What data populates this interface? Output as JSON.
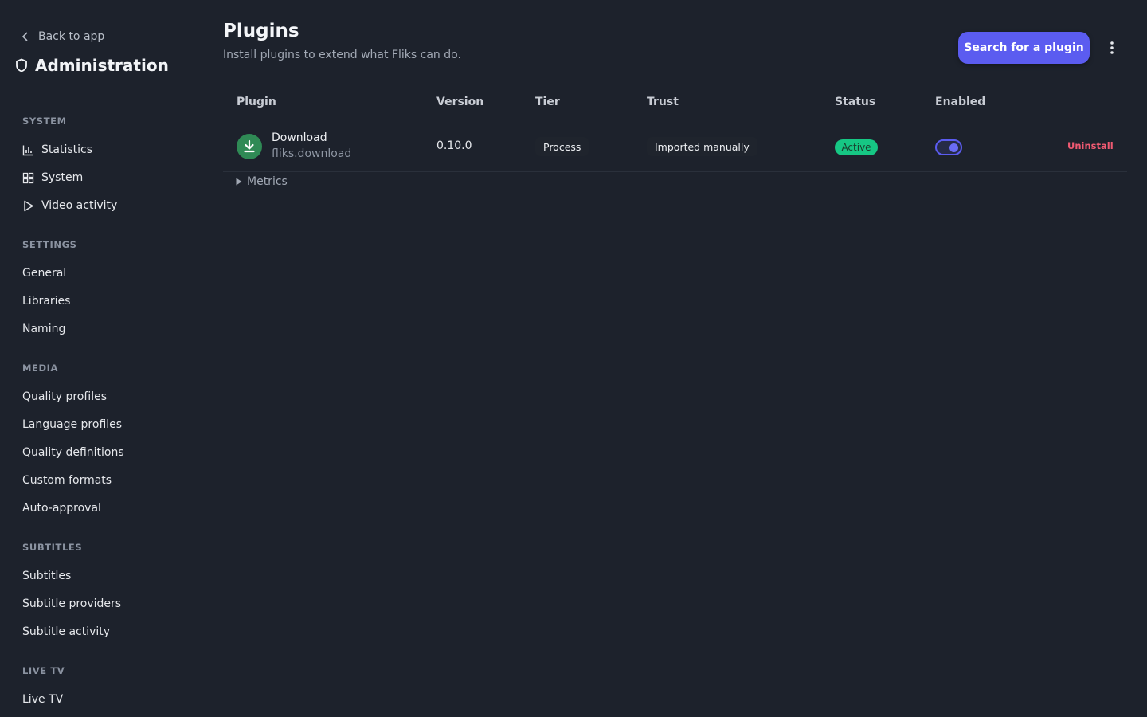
{
  "sidebar": {
    "back_label": "Back to app",
    "title": "Administration",
    "sections": [
      {
        "label": "SYSTEM",
        "items": [
          {
            "label": "Statistics",
            "icon": "bar-chart-icon"
          },
          {
            "label": "System",
            "icon": "grid-icon"
          },
          {
            "label": "Video activity",
            "icon": "play-icon"
          }
        ]
      },
      {
        "label": "SETTINGS",
        "items": [
          {
            "label": "General"
          },
          {
            "label": "Libraries"
          },
          {
            "label": "Naming"
          }
        ]
      },
      {
        "label": "MEDIA",
        "items": [
          {
            "label": "Quality profiles"
          },
          {
            "label": "Language profiles"
          },
          {
            "label": "Quality definitions"
          },
          {
            "label": "Custom formats"
          },
          {
            "label": "Auto-approval"
          }
        ]
      },
      {
        "label": "SUBTITLES",
        "items": [
          {
            "label": "Subtitles"
          },
          {
            "label": "Subtitle providers"
          },
          {
            "label": "Subtitle activity"
          }
        ]
      },
      {
        "label": "LIVE TV",
        "items": [
          {
            "label": "Live TV"
          }
        ]
      }
    ]
  },
  "header": {
    "title": "Plugins",
    "subtitle": "Install plugins to extend what Fliks can do.",
    "search_button": "Search for a plugin"
  },
  "table": {
    "columns": {
      "plugin": "Plugin",
      "version": "Version",
      "tier": "Tier",
      "trust": "Trust",
      "status": "Status",
      "enabled": "Enabled"
    },
    "rows": [
      {
        "name": "Download",
        "id": "fliks.download",
        "icon": "download-icon",
        "version": "0.10.0",
        "tier": "Process",
        "trust": "Imported manually",
        "status": "Active",
        "enabled": true,
        "action": "Uninstall"
      }
    ]
  },
  "metrics_label": "Metrics",
  "colors": {
    "background": "#1d222c",
    "accent": "#5b5cf0",
    "status_active": "#16c784",
    "danger": "#f05a72",
    "plugin_icon": "#2f8a55"
  }
}
